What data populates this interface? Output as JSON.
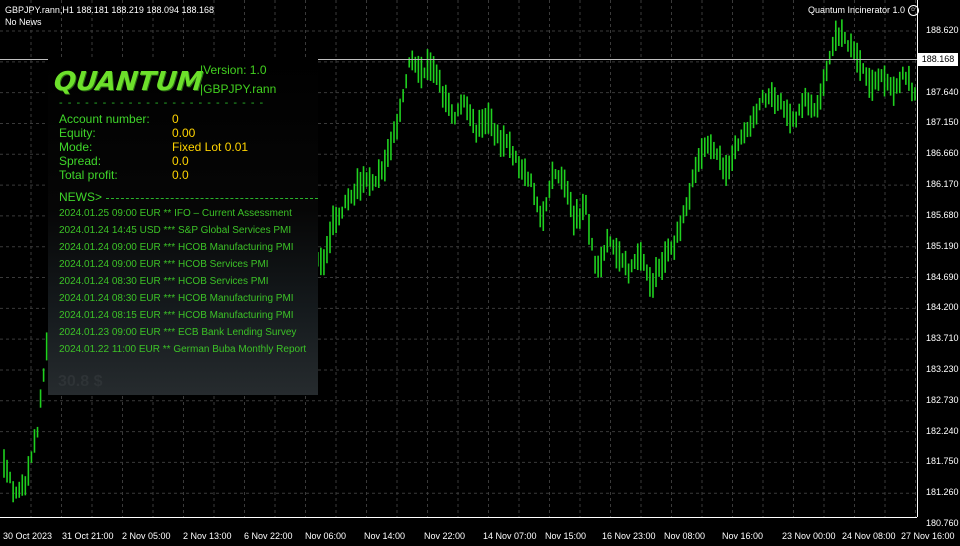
{
  "header": {
    "symbol_line": "GBPJPY.rann,H1  188.181 188.219 188.094 188.168",
    "news_status": "No News",
    "indicator_name": "Quantum Incinerator 1.0",
    "indicator_icon": "smiley-icon"
  },
  "price_axis": {
    "labels": [
      "188.620",
      "188.168",
      "187.640",
      "187.150",
      "186.660",
      "186.170",
      "185.680",
      "185.190",
      "184.690",
      "184.200",
      "183.710",
      "183.230",
      "182.730",
      "182.240",
      "181.750",
      "181.260",
      "180.760"
    ],
    "current_price": "188.168"
  },
  "time_axis": {
    "labels": [
      "30 Oct 2023",
      "31 Oct 21:00",
      "2 Nov 05:00",
      "2 Nov 13:00",
      "6 Nov 22:00",
      "Nov 06:00",
      "Nov 14:00",
      "Nov 22:00",
      "14 Nov 07:00",
      "Nov 15:00",
      "16 Nov 23:00",
      "Nov 08:00",
      "Nov 16:00",
      "23 Nov 00:00",
      "24 Nov 08:00",
      "27 Nov 16:00"
    ]
  },
  "panel": {
    "logo": "QUANTUM",
    "version": "|Version: 1.0",
    "symbol": "|GBPJPY.rann",
    "separator": "- - - - - - - - - - - - - - - - - - - - - - - -",
    "fields": [
      {
        "label": "Account number:",
        "value": "0"
      },
      {
        "label": "Equity:",
        "value": "0.00"
      },
      {
        "label": "Mode:",
        "value": "Fixed Lot 0.01"
      },
      {
        "label": "Spread:",
        "value": "0.0"
      },
      {
        "label": "Total profit:",
        "value": "0.0"
      }
    ],
    "news_header": "NEWS>",
    "news": [
      "2024.01.25 09:00 EUR **  IFO – Current Assessment",
      "2024.01.24 14:45 USD ***  S&P Global Services PMI",
      "2024.01.24 09:00 EUR ***  HCOB Manufacturing PMI",
      "2024.01.24 09:00 EUR ***  HCOB Services PMI",
      "2024.01.24 08:30 EUR ***  HCOB Services PMI",
      "2024.01.24 08:30 EUR ***  HCOB Manufacturing PMI",
      "2024.01.24 08:15 EUR ***  HCOB Manufacturing PMI",
      "2024.01.23 09:00 EUR ***  ECB Bank Lending Survey",
      "2024.01.22 11:00 EUR **  German Buba Monthly Report"
    ],
    "background_number": "30.8 $"
  },
  "colors": {
    "background": "#000000",
    "candles": "#1fd11f",
    "grid": "#3a3a3a",
    "accent": "#6de02b",
    "value_yellow": "#ffd400"
  },
  "chart_data": {
    "type": "line",
    "series": [
      {
        "values": [
          181.8,
          181.2,
          181.4,
          182.2,
          183.7,
          184.5,
          184.0,
          183.0,
          183.4,
          184.1,
          184.8,
          184.3,
          184.7,
          184.2,
          184.9,
          185.0,
          185.2,
          185.5,
          185.3,
          185.1,
          185.4,
          185.2,
          185.1,
          185.3,
          185.0,
          185.2,
          185.1,
          185.5,
          185.0,
          184.9,
          185.6,
          185.8,
          186.1,
          186.3,
          186.2,
          186.7,
          187.2,
          188.2,
          187.9,
          188.1,
          187.6,
          187.2,
          187.5,
          187.0,
          187.3,
          186.9,
          186.8,
          186.4,
          186.3,
          185.5,
          186.3,
          186.2,
          185.6,
          185.8,
          184.8,
          185.3,
          185.0,
          184.8,
          185.1,
          184.6,
          184.9,
          185.2,
          185.7,
          186.4,
          186.8,
          186.6,
          186.4,
          186.9,
          187.1,
          187.5,
          187.6,
          187.4,
          187.2,
          187.6,
          187.3,
          188.0,
          188.6,
          188.4,
          188.1,
          187.7,
          187.9,
          187.6,
          188.0,
          187.6
        ]
      }
    ],
    "ylim": [
      180.76,
      188.62
    ],
    "grid": true
  }
}
